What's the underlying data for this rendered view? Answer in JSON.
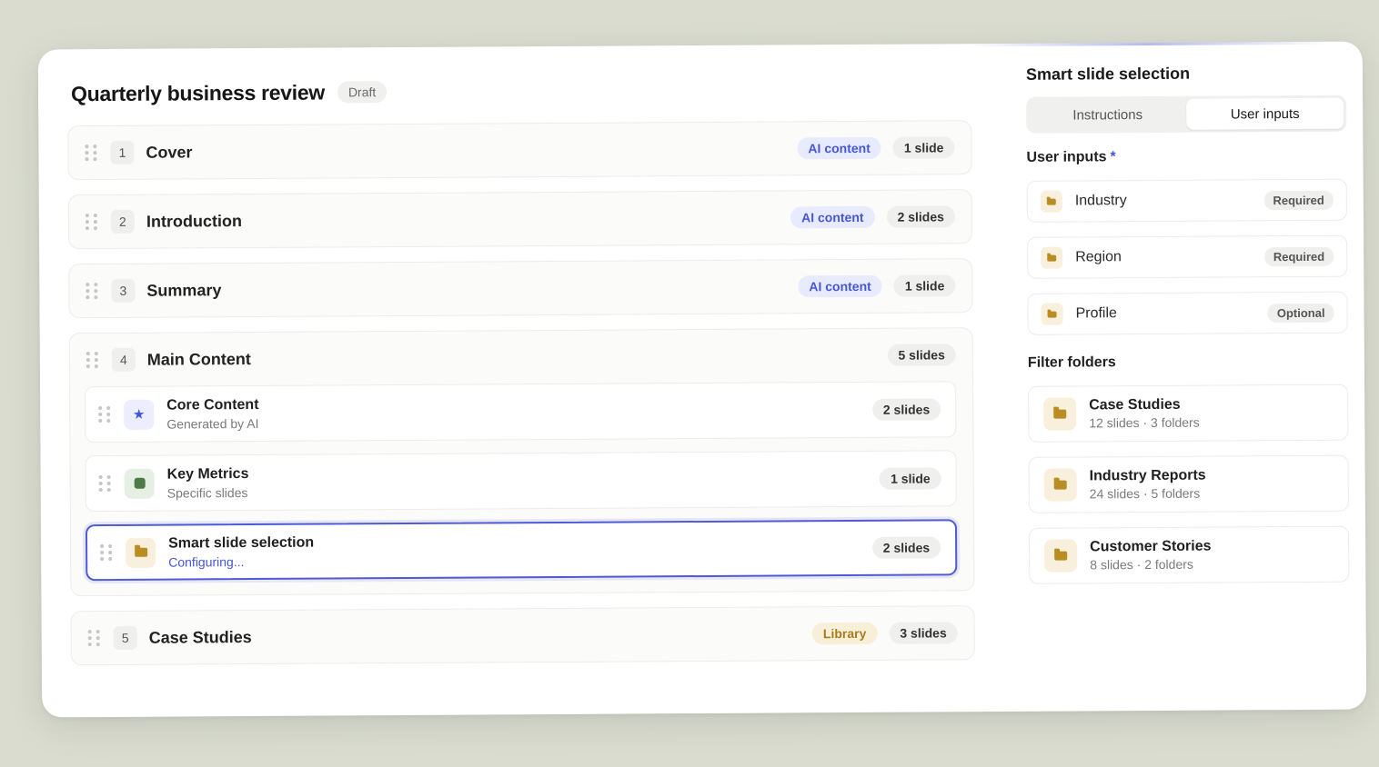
{
  "header": {
    "title": "Quarterly business review",
    "status": "Draft"
  },
  "sections": [
    {
      "number": "1",
      "label": "Cover",
      "tag": "AI content",
      "count": "1 slide"
    },
    {
      "number": "2",
      "label": "Introduction",
      "tag": "AI content",
      "count": "2 slides"
    },
    {
      "number": "3",
      "label": "Summary",
      "tag": "AI content",
      "count": "1 slide"
    },
    {
      "number": "4",
      "label": "Main Content",
      "count": "5 slides",
      "children": [
        {
          "title": "Core Content",
          "desc": "Generated by AI",
          "count": "2 slides",
          "icon": "star-icon"
        },
        {
          "title": "Key Metrics",
          "desc": "Specific slides",
          "count": "1 slide",
          "icon": "square-icon"
        },
        {
          "title": "Smart slide selection",
          "desc": "Configuring...",
          "count": "2 slides",
          "icon": "folder-icon"
        }
      ]
    },
    {
      "number": "5",
      "label": "Case Studies",
      "tag": "Library",
      "count": "3 slides"
    }
  ],
  "panel": {
    "title": "Smart slide selection",
    "tabs": [
      {
        "label": "Instructions"
      },
      {
        "label": "User inputs"
      }
    ],
    "active_tab": "User inputs",
    "user_inputs_label": "User inputs",
    "required_marker": "*",
    "inputs": [
      {
        "label": "Industry",
        "requirement": "Required"
      },
      {
        "label": "Region",
        "requirement": "Required"
      },
      {
        "label": "Profile",
        "requirement": "Optional"
      }
    ],
    "filter_title": "Filter folders",
    "folders": [
      {
        "name": "Case Studies",
        "meta": "12 slides · 3 folders"
      },
      {
        "name": "Industry Reports",
        "meta": "24 slides · 5 folders"
      },
      {
        "name": "Customer Stories",
        "meta": "8 slides · 2 folders"
      }
    ]
  },
  "colors": {
    "accent": "#4f5bd5",
    "ai_tag_bg": "#e8ebfd",
    "library_tag_bg": "#f8efd8",
    "folder_brown": "#b98d24"
  }
}
